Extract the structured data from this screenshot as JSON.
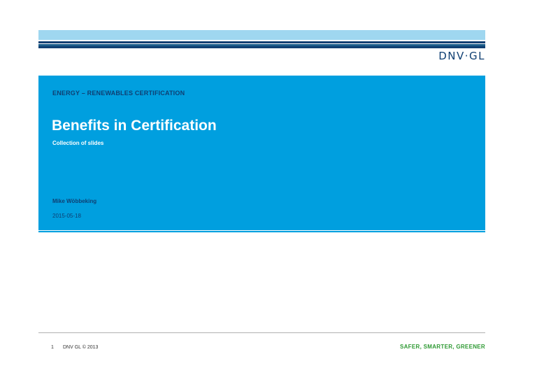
{
  "header": {
    "logo_text": "DNV·GL"
  },
  "hero": {
    "kicker": "ENERGY – RENEWABLES CERTIFICATION",
    "title": "Benefits in Certification",
    "subtitle": "Collection of slides",
    "author": "Mike Wöbbeking",
    "date": "2015-05-18"
  },
  "footer": {
    "page_number": "1",
    "copyright": "DNV GL © 2013",
    "tagline": "SAFER, SMARTER, GREENER"
  },
  "colors": {
    "hero_blue": "#009fdf",
    "light_band": "#9fd7f0",
    "dark_navy": "#0f3f72",
    "tagline_green": "#2f9a34"
  }
}
